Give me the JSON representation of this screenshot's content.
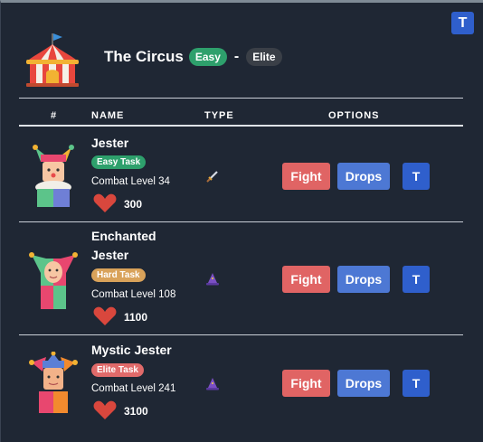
{
  "corner_button": "T",
  "header": {
    "title": "The Circus",
    "difficulty": "Easy",
    "separator": "-",
    "tier": "Elite",
    "icon": "circus-tent-icon"
  },
  "columns": {
    "num": "#",
    "name": "NAME",
    "type": "TYPE",
    "options": "OPTIONS"
  },
  "monsters": [
    {
      "name": "Jester",
      "task": "Easy Task",
      "level": "Combat Level 34",
      "hp": "300",
      "type_icon": "sword-icon",
      "fight": "Fight",
      "drops": "Drops",
      "t": "T"
    },
    {
      "name": "Enchanted Jester",
      "task": "Hard Task",
      "level": "Combat Level 108",
      "hp": "1100",
      "type_icon": "wizard-hat-icon",
      "fight": "Fight",
      "drops": "Drops",
      "t": "T"
    },
    {
      "name": "Mystic Jester",
      "task": "Elite Task",
      "level": "Combat Level 241",
      "hp": "3100",
      "type_icon": "wizard-hat-icon",
      "fight": "Fight",
      "drops": "Drops",
      "t": "T"
    }
  ],
  "colors": {
    "fight": "#e06464",
    "drops": "#4d78d4",
    "t_button": "#2f5fcc",
    "background": "#1f2734"
  }
}
